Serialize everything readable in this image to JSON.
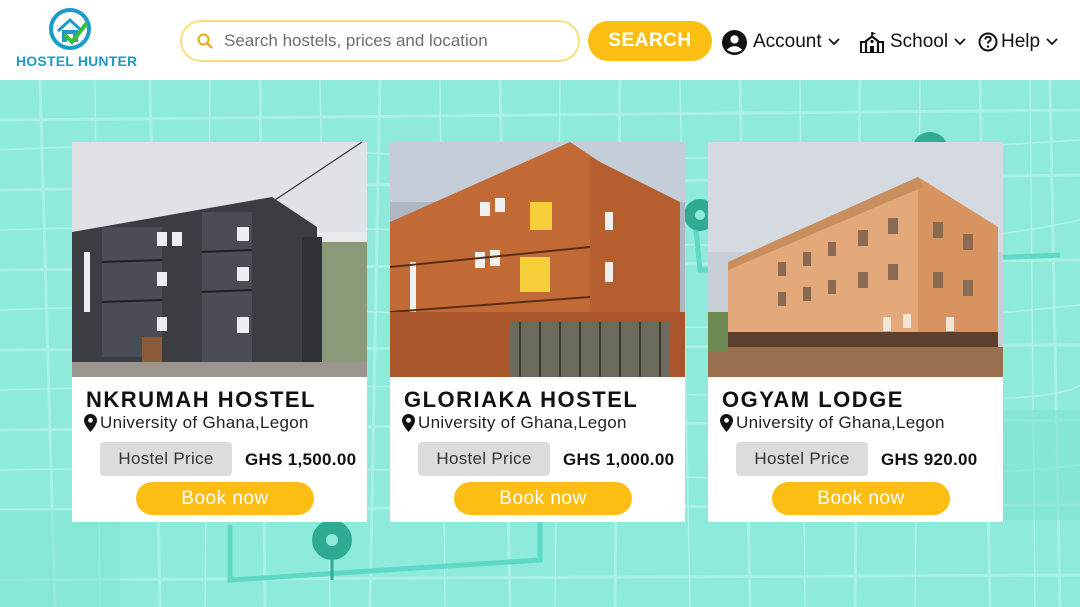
{
  "brand": {
    "name": "HOSTEL HUNTER"
  },
  "search": {
    "placeholder": "Search hostels, prices and location",
    "button_label": "SEARCH"
  },
  "nav": {
    "account_label": "Account",
    "school_label": "School",
    "help_label": "Help"
  },
  "colors": {
    "accent": "#fdbe14",
    "background": "#8eeadb",
    "brand_blue": "#1b9bc9"
  },
  "hostels": [
    {
      "name": "NKRUMAH HOSTEL",
      "location": "University of Ghana,Legon",
      "price_label": "Hostel Price",
      "price": "GHS 1,500.00",
      "book_label": "Book now"
    },
    {
      "name": "GLORIAKA HOSTEL",
      "location": "University of Ghana,Legon",
      "price_label": "Hostel Price",
      "price": "GHS 1,000.00",
      "book_label": "Book now"
    },
    {
      "name": "OGYAM LODGE",
      "location": "University of Ghana,Legon",
      "price_label": "Hostel Price",
      "price": "GHS 920.00",
      "book_label": "Book now"
    }
  ]
}
